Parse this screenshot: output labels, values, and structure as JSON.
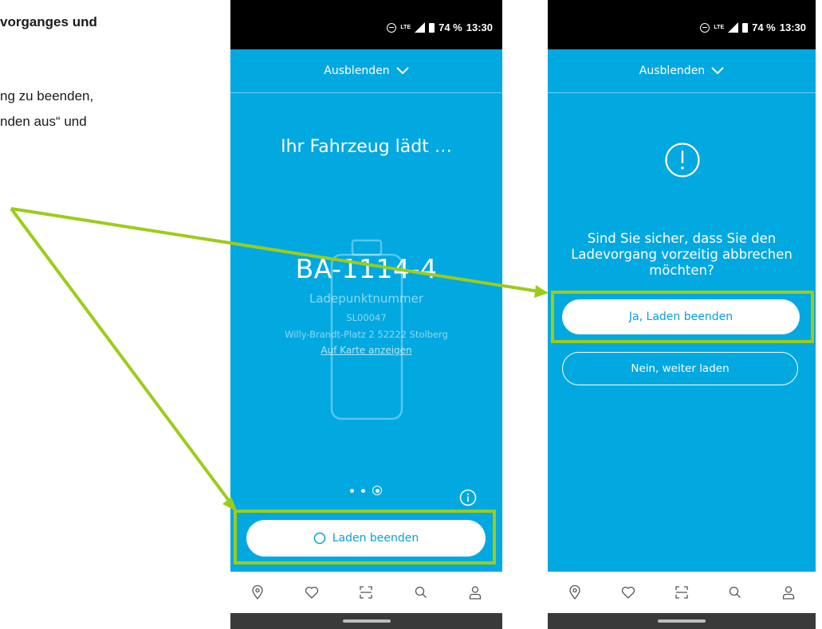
{
  "document": {
    "heading": "vorganges und",
    "lines": [
      "ng zu beenden,",
      "nden aus“ und"
    ]
  },
  "status_bar": {
    "network": "LTE",
    "battery": "74 %",
    "time": "13:30"
  },
  "header": {
    "hide_label": "Ausblenden"
  },
  "charging_screen": {
    "title": "Ihr Fahrzeug lädt …",
    "plate": "BA-1114-4",
    "charge_point_label": "Ladepunktnummer",
    "charge_point_id": "SL00047",
    "address": "Willy-Brandt-Platz 2 52222 Stolberg",
    "map_link": "Auf Karte anzeigen",
    "pager": {
      "count": 3,
      "active": 3
    },
    "stop_button": "Laden beenden"
  },
  "confirm_screen": {
    "question": "Sind Sie sicher, dass Sie den Ladevorgang vorzeitig abbrechen möchten?",
    "confirm_button": "Ja, Laden beenden",
    "cancel_button": "Nein, weiter laden"
  },
  "bottom_nav": {
    "items": [
      "location-pin-icon",
      "heart-icon",
      "scan-icon",
      "search-icon",
      "profile-icon"
    ]
  },
  "colors": {
    "app_blue": "#02a8e0",
    "highlight_green": "#9ccc1a",
    "button_text": "#0aa0d8"
  }
}
